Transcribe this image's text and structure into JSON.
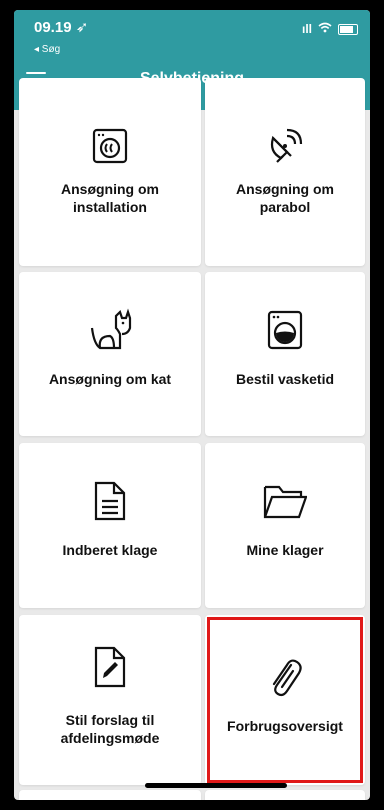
{
  "status_bar": {
    "time": "09.19 ➶",
    "back_label": "◂ Søg",
    "signal": "ıll"
  },
  "header": {
    "title": "Selvbetjening",
    "menu_icon": "hamburger-icon"
  },
  "tiles": [
    {
      "label": "Ansøgning om installation",
      "icon": "washing-machine-icon"
    },
    {
      "label": "Ansøgning om parabol",
      "icon": "satellite-dish-icon"
    },
    {
      "label": "Ansøgning om kat",
      "icon": "cat-icon"
    },
    {
      "label": "Bestil vasketid",
      "icon": "washer-icon"
    },
    {
      "label": "Indberet klage",
      "icon": "document-icon"
    },
    {
      "label": "Mine klager",
      "icon": "folder-icon"
    },
    {
      "label": "Stil forslag til afdelingsmøde",
      "icon": "edit-document-icon"
    },
    {
      "label": "Forbrugsoversigt",
      "icon": "paperclip-icon"
    }
  ],
  "highlighted_tile": "Forbrugsoversigt",
  "colors": {
    "header": "#2f9ba1",
    "background": "#e9e9e9",
    "highlight": "#e01818"
  }
}
